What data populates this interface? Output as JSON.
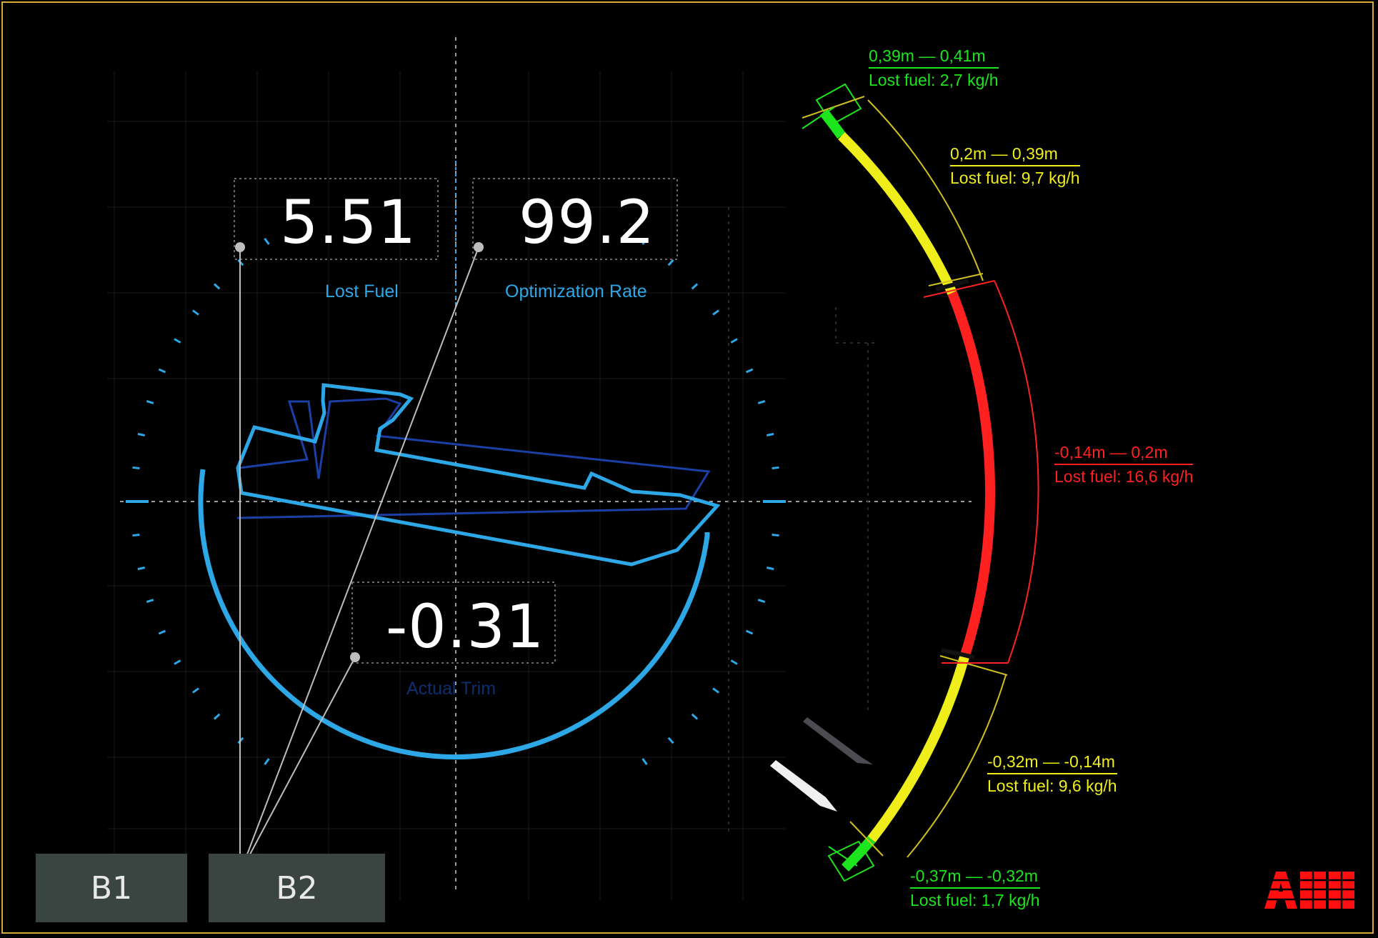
{
  "readouts": {
    "lost_fuel": {
      "value": "5.51",
      "label": "Lost Fuel"
    },
    "optimization_rate": {
      "value": "99.2",
      "label": "Optimization Rate"
    },
    "actual_trim": {
      "value": "-0.31",
      "label": "Actual Trim"
    }
  },
  "trim_ranges": [
    {
      "range": "0,39m  —  0,41m",
      "lost_fuel": "Lost fuel: 2,7 kg/h",
      "color": "#1de51d"
    },
    {
      "range": "0,2m  —  0,39m",
      "lost_fuel": "Lost fuel: 9,7 kg/h",
      "color": "#f0ee1a"
    },
    {
      "range": "-0,14m  —  0,2m",
      "lost_fuel": "Lost fuel: 16,6 kg/h",
      "color": "#ff2020"
    },
    {
      "range": "-0,32m  —  -0,14m",
      "lost_fuel": "Lost fuel: 9,6 kg/h",
      "color": "#f0ee1a"
    },
    {
      "range": "-0,37m  —  -0,32m",
      "lost_fuel": "Lost fuel: 1,7 kg/h",
      "color": "#1de51d"
    }
  ],
  "buttons": {
    "b1": "B1",
    "b2": "B2"
  },
  "logo": "ABB",
  "colors": {
    "accent": "#2ea7e6",
    "frame": "#d8a93a",
    "button_bg": "#3a4542"
  }
}
